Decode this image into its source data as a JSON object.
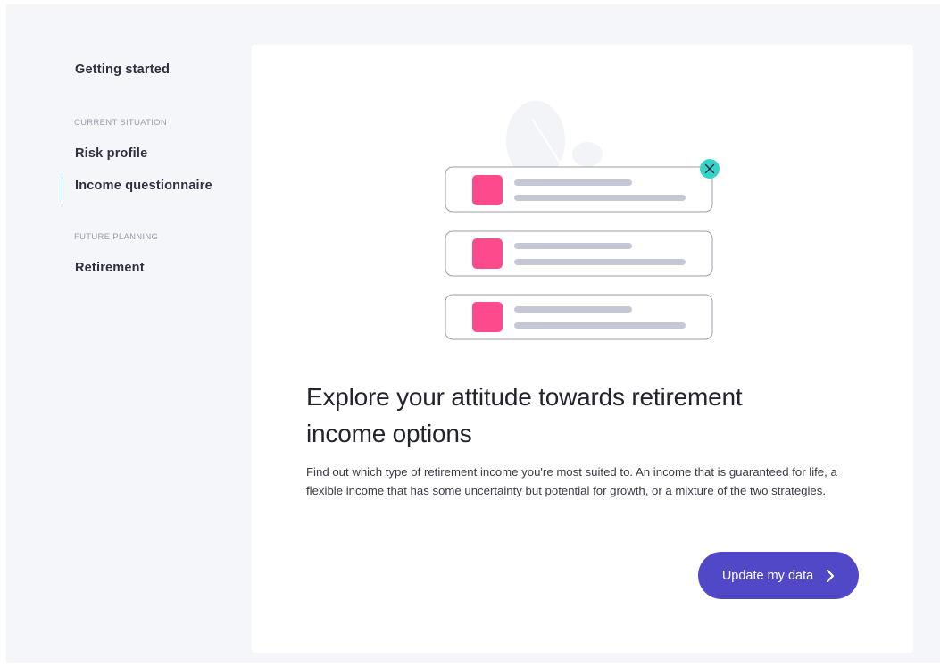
{
  "sidebar": {
    "getting_started": "Getting started",
    "sections": [
      {
        "title": "CURRENT SITUATION",
        "items": [
          "Risk profile",
          "Income questionnaire"
        ]
      },
      {
        "title": "FUTURE PLANNING",
        "items": [
          "Retirement"
        ]
      }
    ],
    "active_item": "Income questionnaire"
  },
  "main": {
    "headline": "Explore your attitude towards retirement income options",
    "description": "Find out which type of retirement income you're most suited to. An income that is guaranteed for life, a flexible income that has some uncertainty but potential for growth, or a mixture of the two strategies.",
    "cta_label": "Update my data",
    "illustration": {
      "icon": "list-cards-illustration",
      "card_count": 3,
      "close_badge_icon": "close-icon"
    }
  },
  "colors": {
    "background": "#f5f6fa",
    "card": "#ffffff",
    "accent_button": "#5048c7",
    "active_indicator": "#4db6c7",
    "illustration_pink": "#fc4a8c",
    "illustration_teal": "#37d3c8",
    "illustration_gray": "#c5c8d4"
  }
}
